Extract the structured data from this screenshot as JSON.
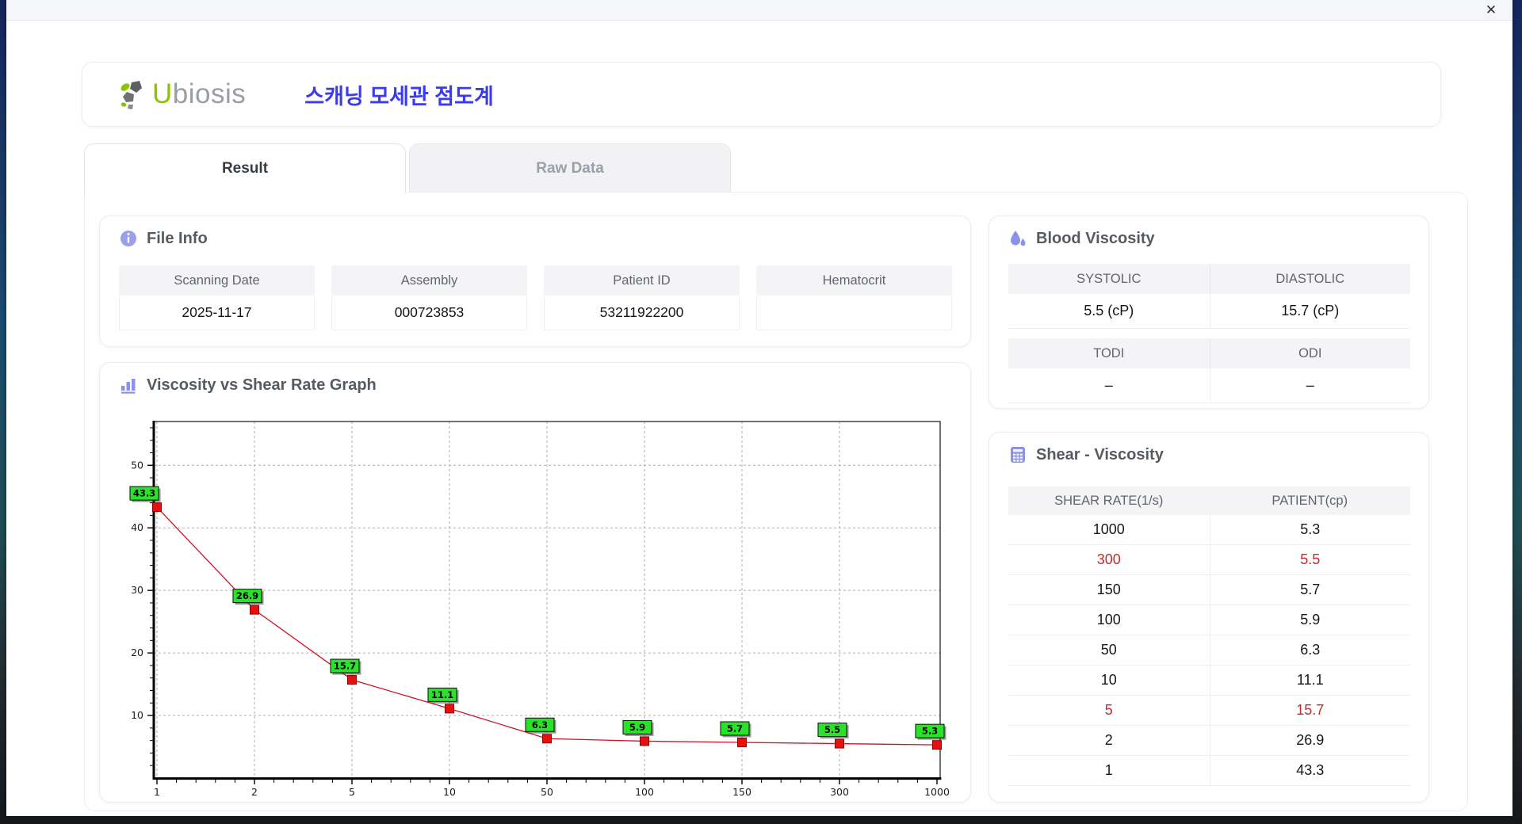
{
  "window": {
    "close_label": "✕"
  },
  "header": {
    "logo_prefix": "U",
    "logo_rest": "biosis",
    "app_title": "스캐닝 모세관 점도계",
    "accent_color": "#3a3af2",
    "logo_green": "#8bc400"
  },
  "tabs": [
    {
      "label": "Result",
      "active": true
    },
    {
      "label": "Raw Data",
      "active": false
    }
  ],
  "file_info": {
    "title": "File Info",
    "fields": [
      {
        "label": "Scanning Date",
        "value": "2025-11-17"
      },
      {
        "label": "Assembly",
        "value": "000723853"
      },
      {
        "label": "Patient ID",
        "value": "53211922200"
      },
      {
        "label": "Hematocrit",
        "value": ""
      }
    ]
  },
  "blood_viscosity": {
    "title": "Blood Viscosity",
    "groups": [
      {
        "headers": [
          "SYSTOLIC",
          "DIASTOLIC"
        ],
        "values": [
          "5.5 (cP)",
          "15.7 (cP)"
        ]
      },
      {
        "headers": [
          "TODI",
          "ODI"
        ],
        "values": [
          "–",
          "–"
        ]
      }
    ]
  },
  "graph": {
    "title": "Viscosity vs Shear Rate Graph"
  },
  "chart_data": {
    "type": "line",
    "title": "Viscosity vs Shear Rate Graph",
    "x": [
      1,
      2,
      5,
      10,
      50,
      100,
      150,
      300,
      1000
    ],
    "x_scale": "categorical",
    "series": [
      {
        "name": "PATIENT",
        "values": [
          43.3,
          26.9,
          15.7,
          11.1,
          6.3,
          5.9,
          5.7,
          5.5,
          5.3
        ]
      }
    ],
    "point_labels": [
      "43.3",
      "26.9",
      "15.7",
      "11.1",
      "6.3",
      "5.9",
      "5.7",
      "5.5",
      "5.3"
    ],
    "xlabel": "",
    "ylabel": "",
    "ylim": [
      0,
      57
    ],
    "y_ticks": [
      10,
      20,
      30,
      40,
      50
    ],
    "grid": true,
    "line_color": "#d01025",
    "marker_color": "#e90f0f",
    "marker_stroke": "#8b0000",
    "label_bg": "#2be22b",
    "label_text_color": "#000000"
  },
  "shear_viscosity": {
    "title": "Shear - Viscosity",
    "columns": [
      "SHEAR RATE(1/s)",
      "PATIENT(cp)"
    ],
    "highlight_color": "#c9282d",
    "rows": [
      {
        "shear_rate": "1000",
        "patient": "5.3",
        "highlight": false
      },
      {
        "shear_rate": "300",
        "patient": "5.5",
        "highlight": true
      },
      {
        "shear_rate": "150",
        "patient": "5.7",
        "highlight": false
      },
      {
        "shear_rate": "100",
        "patient": "5.9",
        "highlight": false
      },
      {
        "shear_rate": "50",
        "patient": "6.3",
        "highlight": false
      },
      {
        "shear_rate": "10",
        "patient": "11.1",
        "highlight": false
      },
      {
        "shear_rate": "5",
        "patient": "15.7",
        "highlight": true
      },
      {
        "shear_rate": "2",
        "patient": "26.9",
        "highlight": false
      },
      {
        "shear_rate": "1",
        "patient": "43.3",
        "highlight": false
      }
    ]
  }
}
